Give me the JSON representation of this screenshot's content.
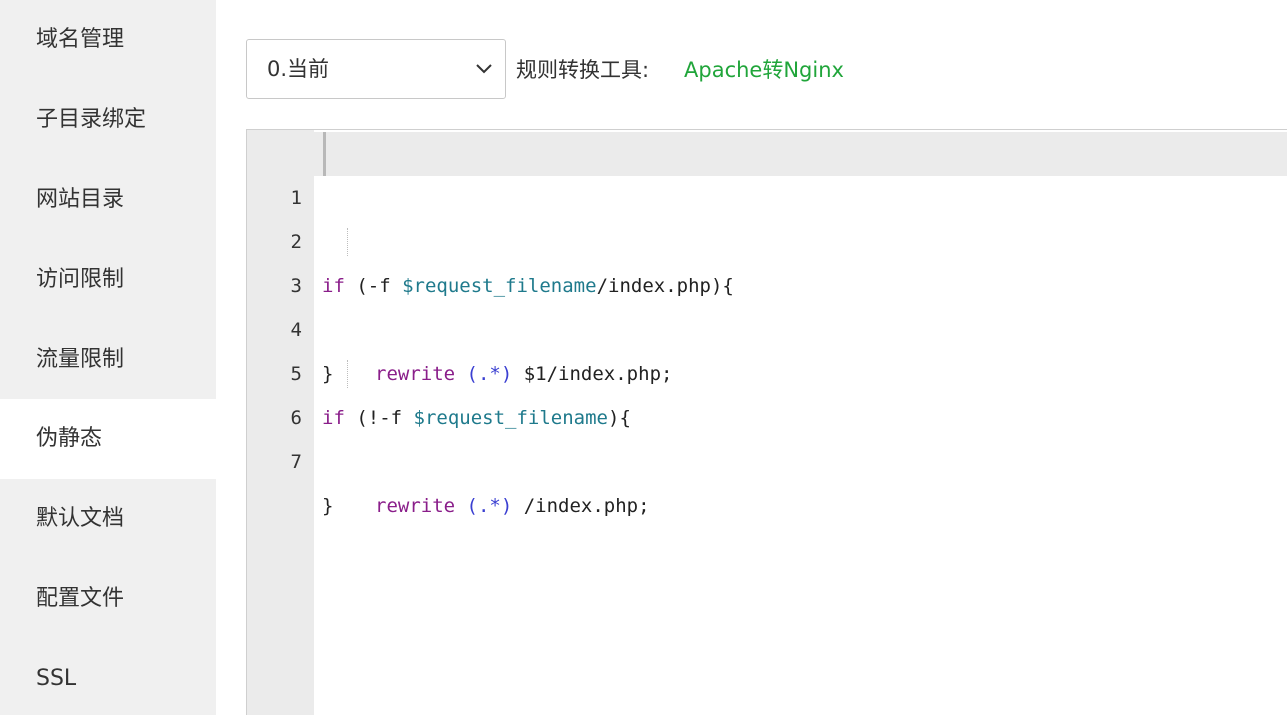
{
  "sidebar": {
    "items": [
      {
        "label": "域名管理"
      },
      {
        "label": "子目录绑定"
      },
      {
        "label": "网站目录"
      },
      {
        "label": "访问限制"
      },
      {
        "label": "流量限制"
      },
      {
        "label": "伪静态",
        "active": true
      },
      {
        "label": "默认文档"
      },
      {
        "label": "配置文件"
      },
      {
        "label": "SSL"
      }
    ]
  },
  "toolbar": {
    "template_select": {
      "value": "0.当前"
    },
    "convert_label": "规则转换工具:",
    "convert_link": "Apache转Nginx",
    "link_color": "#20a53a"
  },
  "editor": {
    "lines": [
      {
        "num": "1"
      },
      {
        "num": "2",
        "t_if": "if",
        "t_open": " (-f ",
        "t_var": "$request_filename",
        "t_rest": "/index.php){"
      },
      {
        "num": "3",
        "t_kw": "rewrite",
        "t_grp": "(.*)",
        "t_rest": " $1/index.php;"
      },
      {
        "num": "4",
        "t_rest": "}"
      },
      {
        "num": "5",
        "t_if": "if",
        "t_open": " (!-f ",
        "t_var": "$request_filename",
        "t_rest": "){"
      },
      {
        "num": "6",
        "t_kw": "rewrite",
        "t_grp": "(.*)",
        "t_rest": " /index.php;"
      },
      {
        "num": "7",
        "t_rest": "}"
      }
    ]
  }
}
